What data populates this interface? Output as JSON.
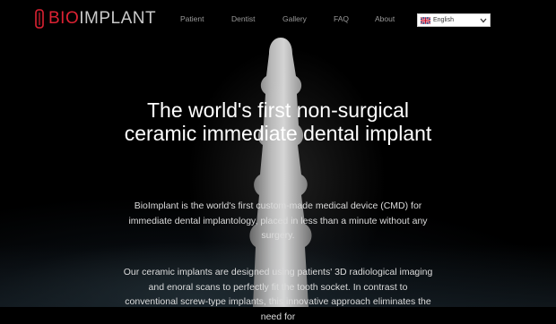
{
  "logo": {
    "text_bio": "BIO",
    "text_rest": "IMPLANT"
  },
  "nav": {
    "items": [
      "Patient",
      "Dentist",
      "Gallery",
      "FAQ",
      "About"
    ]
  },
  "language": {
    "selected": "English",
    "flag_icon": "uk-flag-icon"
  },
  "hero": {
    "title_line1": "The world's first non-surgical",
    "title_line2": "ceramic immediate dental implant",
    "paragraph1": "BioImplant is the world's first custom-made medical device (CMD) for immediate dental implantology, placed in less than a minute without any surgery.",
    "paragraph2": "Our ceramic implants are designed using patients' 3D radiological imaging and enoral scans to perfectly fit the tooth socket. In contrast to conventional screw-type implants, this innovative approach eliminates the need for"
  },
  "colors": {
    "background": "#000000",
    "brand_red": "#dd2233",
    "nav_text": "#9a9a9a",
    "hero_text": "#ffffff"
  }
}
